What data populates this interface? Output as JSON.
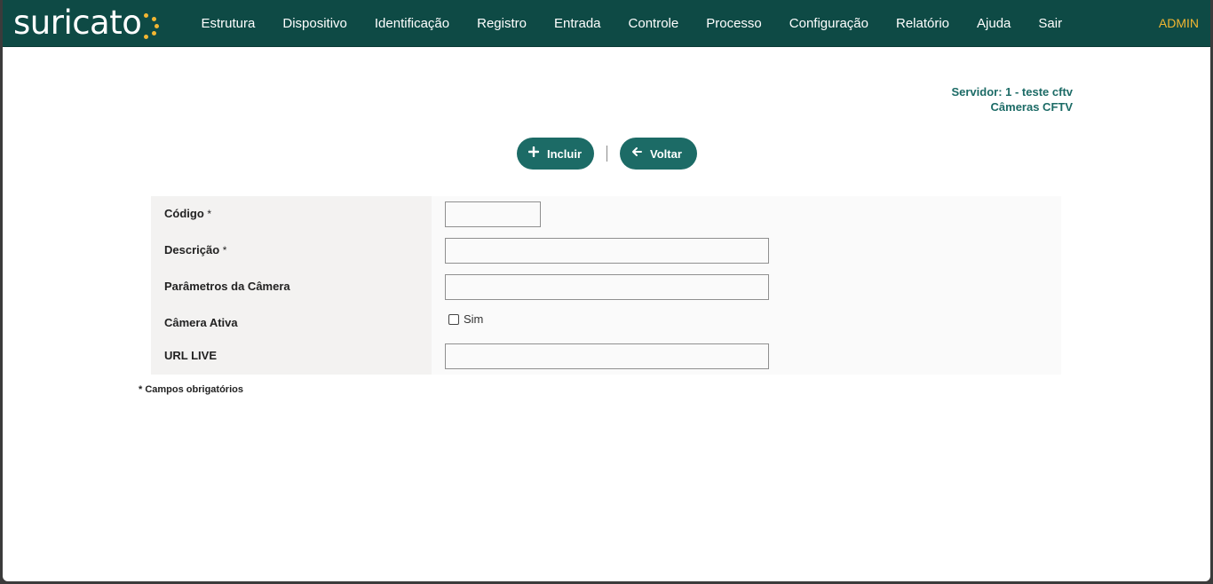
{
  "header": {
    "logo_text": "suricato",
    "nav": [
      "Estrutura",
      "Dispositivo",
      "Identificação",
      "Registro",
      "Entrada",
      "Controle",
      "Processo",
      "Configuração",
      "Relatório",
      "Ajuda",
      "Sair"
    ],
    "user": "ADMIN"
  },
  "info": {
    "server": "Servidor: 1 - teste cftv",
    "section": "Câmeras CFTV"
  },
  "actions": {
    "include_label": "Incluir",
    "back_label": "Voltar"
  },
  "form": {
    "codigo_label": "Código",
    "descricao_label": "Descrição",
    "parametros_label": "Parâmetros da Câmera",
    "ativa_label": "Câmera Ativa",
    "ativa_option": "Sim",
    "url_label": "URL LIVE",
    "required_mark": "*",
    "codigo_value": "",
    "descricao_value": "",
    "parametros_value": "",
    "url_value": ""
  },
  "footnote": "* Campos obrigatórios",
  "colors": {
    "topbar": "#0e4a45",
    "accent": "#1c6b66",
    "admin": "#f2b632"
  }
}
